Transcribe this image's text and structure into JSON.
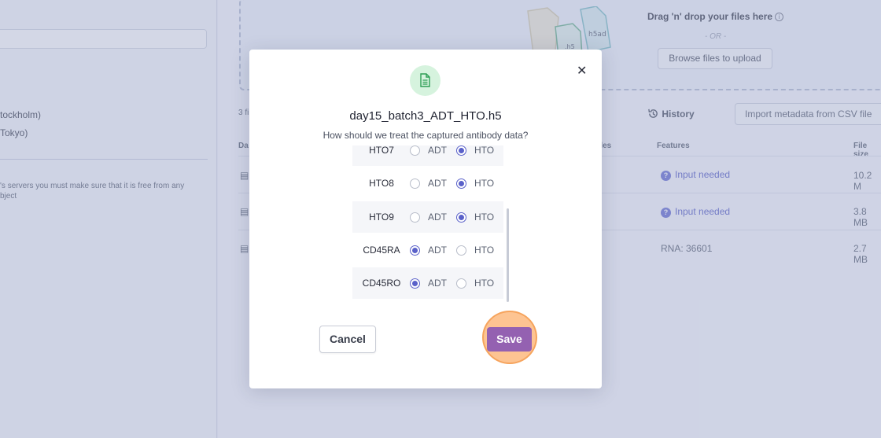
{
  "left_panel": {
    "regions": [
      "tockholm)",
      "Tokyo)"
    ],
    "note": "'s servers you must make sure that it is free from any bject"
  },
  "dropzone": {
    "title": "Drag 'n' drop your files here",
    "info_icon": "info-icon",
    "or_text": "- OR -",
    "browse_label": "Browse files to upload",
    "illustration_label": "h5ad",
    "illustration_label_2": ".h5"
  },
  "files_table": {
    "count_text": "3 fi",
    "history_label": "History",
    "import_label": "Import metadata from CSV file",
    "headers": {
      "name": "Da",
      "barcodes": "des",
      "features": "Features",
      "file_size": "File size"
    },
    "rows": [
      {
        "features": "Input needed",
        "status": "needed",
        "file_size": "10.2 M"
      },
      {
        "features": "Input needed",
        "status": "needed",
        "file_size": "3.8 MB"
      },
      {
        "features": "RNA: 36601",
        "status": "ok",
        "file_size": "2.7 MB"
      }
    ]
  },
  "modal": {
    "icon": "document-icon",
    "title": "day15_batch3_ADT_HTO.h5",
    "subtitle": "How should we treat the captured antibody data?",
    "option_adt": "ADT",
    "option_hto": "HTO",
    "antibodies": [
      {
        "name": "HTO7",
        "selected": "HTO"
      },
      {
        "name": "HTO8",
        "selected": "HTO"
      },
      {
        "name": "HTO9",
        "selected": "HTO"
      },
      {
        "name": "CD45RA",
        "selected": "ADT"
      },
      {
        "name": "CD45RO",
        "selected": "ADT"
      }
    ],
    "cancel_label": "Cancel",
    "save_label": "Save",
    "close_icon": "close-icon"
  },
  "colors": {
    "accent": "#5a61c9",
    "save": "#9461b1",
    "highlight": "#f6a45d",
    "badge_bg": "#d6f3de",
    "badge_icon": "#2e9e55"
  }
}
